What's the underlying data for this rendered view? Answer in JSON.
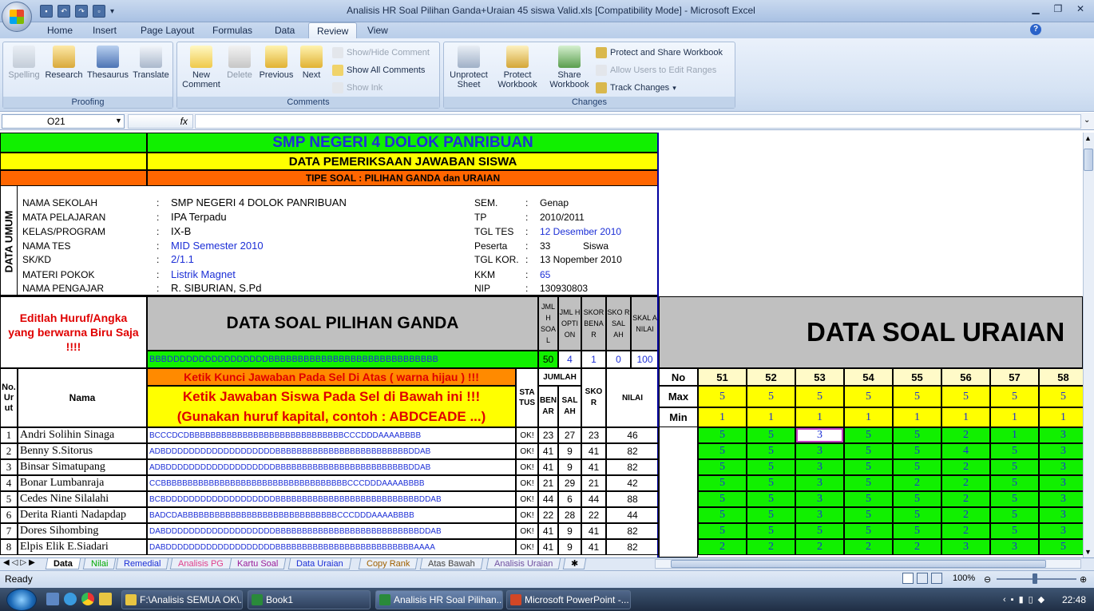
{
  "window": {
    "title": "Analisis HR Soal Pilihan Ganda+Uraian 45 siswa Valid.xls  [Compatibility Mode] - Microsoft Excel"
  },
  "ribbon_tabs": [
    "Home",
    "Insert",
    "Page Layout",
    "Formulas",
    "Data",
    "Review",
    "View"
  ],
  "active_tab": "Review",
  "ribbon": {
    "proofing": {
      "title": "Proofing",
      "buttons": [
        "Spelling",
        "Research",
        "Thesaurus",
        "Translate"
      ]
    },
    "comments": {
      "title": "Comments",
      "new_l1": "New",
      "new_l2": "Comment",
      "delete": "Delete",
      "previous": "Previous",
      "next": "Next",
      "show_hide": "Show/Hide Comment",
      "show_all": "Show All Comments",
      "show_ink": "Show Ink"
    },
    "changes": {
      "title": "Changes",
      "unprotect_l1": "Unprotect",
      "unprotect_l2": "Sheet",
      "protect_l1": "Protect",
      "protect_l2": "Workbook",
      "share_l1": "Share",
      "share_l2": "Workbook",
      "protect_share": "Protect and Share Workbook",
      "allow_users": "Allow Users to Edit Ranges",
      "track_changes": "Track Changes"
    }
  },
  "formula_bar": {
    "name_box": "O21",
    "fx": "fx",
    "formula": ""
  },
  "sheet": {
    "school_title": "SMP NEGERI 4 DOLOK PANRIBUAN",
    "subtitle": "DATA PEMERIKSAAN JAWABAN SISWA",
    "question_type": "TIPE SOAL : PILIHAN GANDA dan URAIAN",
    "side_label": "DATA UMUM",
    "info_left": [
      {
        "label": "NAMA SEKOLAH",
        "value": "SMP NEGERI 4 DOLOK PANRIBUAN",
        "blue": false
      },
      {
        "label": "MATA PELAJARAN",
        "value": "IPA Terpadu",
        "blue": false
      },
      {
        "label": "KELAS/PROGRAM",
        "value": "IX-B",
        "blue": false
      },
      {
        "label": "NAMA TES",
        "value": "MID Semester 2010",
        "blue": true
      },
      {
        "label": "SK/KD",
        "value": "2/1.1",
        "blue": true
      },
      {
        "label": "MATERI POKOK",
        "value": "Listrik Magnet",
        "blue": true
      },
      {
        "label": "NAMA PENGAJAR",
        "value": "R. SIBURIAN, S.Pd",
        "blue": false
      }
    ],
    "info_right": [
      {
        "label": "SEM.",
        "value": "Genap",
        "blue": false
      },
      {
        "label": "TP",
        "value": "2010/2011",
        "blue": false
      },
      {
        "label": "TGL TES",
        "value": "12 Desember 2010",
        "blue": true
      },
      {
        "label": "Peserta",
        "value": "33",
        "extra": "Siswa",
        "blue": false
      },
      {
        "label": "TGL KOR.",
        "value": "13 Nopember 2010",
        "blue": false
      },
      {
        "label": "KKM",
        "value": "65",
        "blue": true
      },
      {
        "label": "NIP",
        "value": "130930803",
        "blue": false
      }
    ],
    "colon": ":",
    "edit_note": "Editlah Huruf/Angka yang berwarna Biru Saja !!!!",
    "pg_header": "DATA SOAL PILIHAN GANDA",
    "answer_key": "BBBDDDDDDDDDDDDDDDDBBBBBBBBBBBBBBBBBBBBBBBBBBBBB",
    "stats_headers": [
      "JML H SOA L",
      "JML H OPTI ON",
      "SKOR BENA R",
      "SKO R SAL AH",
      "SKAL A NILAI"
    ],
    "stats_values": [
      "50",
      "4",
      "1",
      "0",
      "100"
    ],
    "uraian_header": "DATA SOAL URAIAN",
    "instr1": "Ketik Kunci Jawaban Pada Sel Di Atas ( warna hijau ) !!!",
    "instr2a": "Ketik Jawaban Siswa Pada Sel di Bawah ini !!!",
    "instr2b": "(Gunakan huruf kapital, contoh : ABDCEADE ...)",
    "col_no": "No. Ur ut",
    "col_nama": "Nama",
    "col_status": "STA TUS",
    "col_jumlah": "JUMLAH",
    "col_benar": "BEN AR",
    "col_salah": "SAL AH",
    "col_skor": "SKO R",
    "col_nilai": "NILAI",
    "uraian_no_label": "No",
    "uraian_max_label": "Max",
    "uraian_min_label": "Min",
    "uraian_numbers": [
      "51",
      "52",
      "53",
      "54",
      "55",
      "56",
      "57",
      "58"
    ],
    "uraian_max": [
      "5",
      "5",
      "5",
      "5",
      "5",
      "5",
      "5",
      "5"
    ],
    "uraian_min": [
      "1",
      "1",
      "1",
      "1",
      "1",
      "1",
      "1",
      "1"
    ],
    "students": [
      {
        "no": "1",
        "nama": "Andri Solihin Sinaga",
        "jawaban": "BCCCDCDBBBBBBBBBBBBBBBBBBBBBBBBBBBBBCCCDDDAAAABBBB",
        "status": "OK!",
        "benar": "23",
        "salah": "27",
        "skor": "23",
        "nilai": "46",
        "uraian": [
          "5",
          "5",
          "3",
          "5",
          "5",
          "2",
          "1",
          "3"
        ]
      },
      {
        "no": "2",
        "nama": "Benny S.Sitorus",
        "jawaban": "ADBDDDDDDDDDDDDDDDDDDDBBBBBBBBBBBBBBBBBBBBBBBBBDDAB",
        "status": "OK!",
        "benar": "41",
        "salah": "9",
        "skor": "41",
        "nilai": "82",
        "uraian": [
          "5",
          "5",
          "3",
          "5",
          "5",
          "4",
          "5",
          "3"
        ]
      },
      {
        "no": "3",
        "nama": "Binsar Simatupang",
        "jawaban": "ADBDDDDDDDDDDDDDDDDDDDBBBBBBBBBBBBBBBBBBBBBBBBBDDAB",
        "status": "OK!",
        "benar": "41",
        "salah": "9",
        "skor": "41",
        "nilai": "82",
        "uraian": [
          "5",
          "5",
          "3",
          "5",
          "5",
          "2",
          "5",
          "3"
        ]
      },
      {
        "no": "4",
        "nama": "Bonar Lumbanraja",
        "jawaban": "CCBBBBBBBBBBBBBBBBBBBBBBBBBBBBBBBBBBBCCCDDDAAAABBBB",
        "status": "OK!",
        "benar": "21",
        "salah": "29",
        "skor": "21",
        "nilai": "42",
        "uraian": [
          "5",
          "5",
          "3",
          "5",
          "2",
          "2",
          "5",
          "3"
        ]
      },
      {
        "no": "5",
        "nama": "Cedes Nine Silalahi",
        "jawaban": "BCBDDDDDDDDDDDDDDDDDDDBBBBBBBBBBBBBBBBBBBBBBBBBBBDDAB",
        "status": "OK!",
        "benar": "44",
        "salah": "6",
        "skor": "44",
        "nilai": "88",
        "uraian": [
          "5",
          "5",
          "3",
          "5",
          "5",
          "2",
          "5",
          "3"
        ]
      },
      {
        "no": "6",
        "nama": "Derita Rianti Nadapdap",
        "jawaban": "BADCDABBBBBBBBBBBBBBBBBBBBBBBBBBBBBCCCDDDAAAABBBB",
        "status": "OK!",
        "benar": "22",
        "salah": "28",
        "skor": "22",
        "nilai": "44",
        "uraian": [
          "5",
          "5",
          "3",
          "5",
          "5",
          "2",
          "5",
          "3"
        ]
      },
      {
        "no": "7",
        "nama": "Dores Sihombing",
        "jawaban": "DABDDDDDDDDDDDDDDDDDDDBBBBBBBBBBBBBBBBBBBBBBBBBBBDDAB",
        "status": "OK!",
        "benar": "41",
        "salah": "9",
        "skor": "41",
        "nilai": "82",
        "uraian": [
          "5",
          "5",
          "5",
          "5",
          "5",
          "2",
          "5",
          "3"
        ]
      },
      {
        "no": "8",
        "nama": "Elpis Elik E.Siadari",
        "jawaban": "DABDDDDDDDDDDDDDDDDDDDBBBBBBBBBBBBBBBBBBBBBBBBBBAAAA",
        "status": "OK!",
        "benar": "41",
        "salah": "9",
        "skor": "41",
        "nilai": "82",
        "uraian": [
          "2",
          "2",
          "2",
          "2",
          "2",
          "3",
          "3",
          "5"
        ]
      }
    ]
  },
  "sheet_tabs": [
    "Data",
    "Nilai",
    "Remedial",
    "Analisis PG",
    "Kartu Soal",
    "Data Uraian",
    "Copy Rank",
    "Atas Bawah",
    "Analisis Uraian"
  ],
  "active_sheet": "Data",
  "status": {
    "ready": "Ready",
    "zoom": "100%"
  },
  "taskbar": {
    "items": [
      "F:\\Analisis SEMUA OK\\...",
      "Book1",
      "Analisis HR Soal Pilihan...",
      "Microsoft PowerPoint -..."
    ],
    "clock": "22:48"
  }
}
